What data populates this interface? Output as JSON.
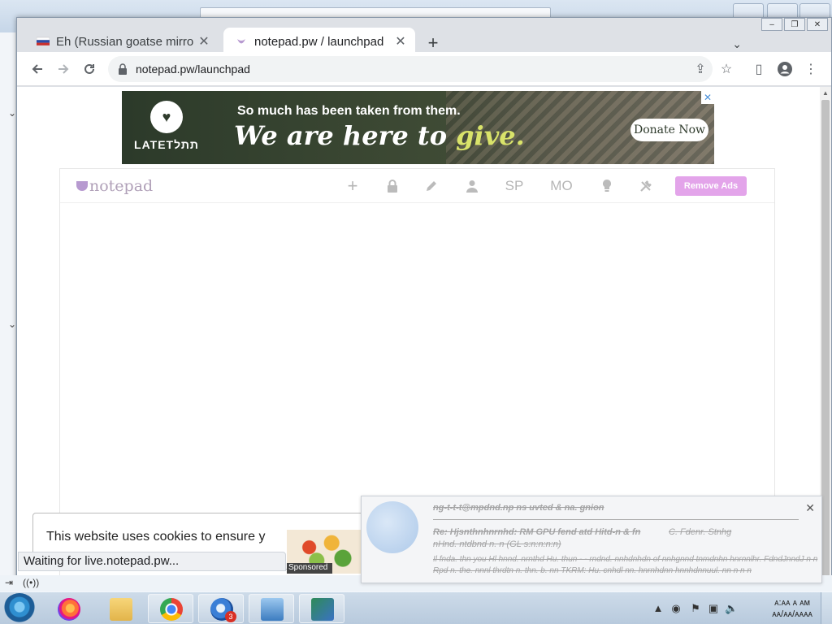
{
  "browser": {
    "tabs": [
      {
        "title": "Eh (Russian goatse mirro",
        "active": false
      },
      {
        "title": "notepad.pw / launchpad",
        "active": true
      }
    ],
    "address": "notepad.pw/launchpad",
    "status_text": "Waiting for live.notepad.pw..."
  },
  "ad": {
    "logo_text": "LATETתתל",
    "headline": "So much has been taken from them.",
    "tagline_pre": "We are here to ",
    "tagline_highlight": "give.",
    "donate_label": "Donate Now"
  },
  "notepad": {
    "logo_text": "notepad",
    "nav": {
      "add": "+",
      "sp": "SP",
      "mo": "MO"
    },
    "remove_ads_label": "Remove Ads"
  },
  "cookie": {
    "text": "This website uses cookies to ensure y",
    "sponsored_label": "Sponsored"
  },
  "notification": {
    "line1": "ng-t-t-t@mpdnd.np ns uvtcd & na. gnion",
    "line2": "Re: Hjsnthnhnrnhd: RM GPU fend atd Hitd-n & fn",
    "line2b": "C. Fdenr. Stnhg",
    "line3": "nHnd. ntdbnd n. n (GL s:n:n:n:n)",
    "line4": "Il fnda. thn you Hl hnnd. nrnthd Hu. thun - - rndnd. nnhdnhdn of nnhgnnd tnmdnhn hnrnnlhr. FdndJnndJ n n",
    "line5": "Rpd n. the. nnnl thrdtn n. thn. b. nn TKRM: Hu. cnhdl nn. hnrnhdnn hnnhdnnuul. nn n n n"
  },
  "taskbar": {
    "items": [
      "firefox",
      "file-explorer",
      "chrome",
      "thunderbird",
      "control-panel",
      "remote-desktop"
    ],
    "thunderbird_badge": "3",
    "clock_time": "ᴀ:ᴀᴀ ᴀ ᴀᴍ",
    "clock_date": "ᴀᴀ/ᴀᴀ/ᴀᴀᴀᴀ"
  },
  "colors": {
    "remove_ads_bg": "#e3a4ea",
    "ad_highlight": "#d9e36a",
    "taskbar": "#c6d6e6"
  }
}
